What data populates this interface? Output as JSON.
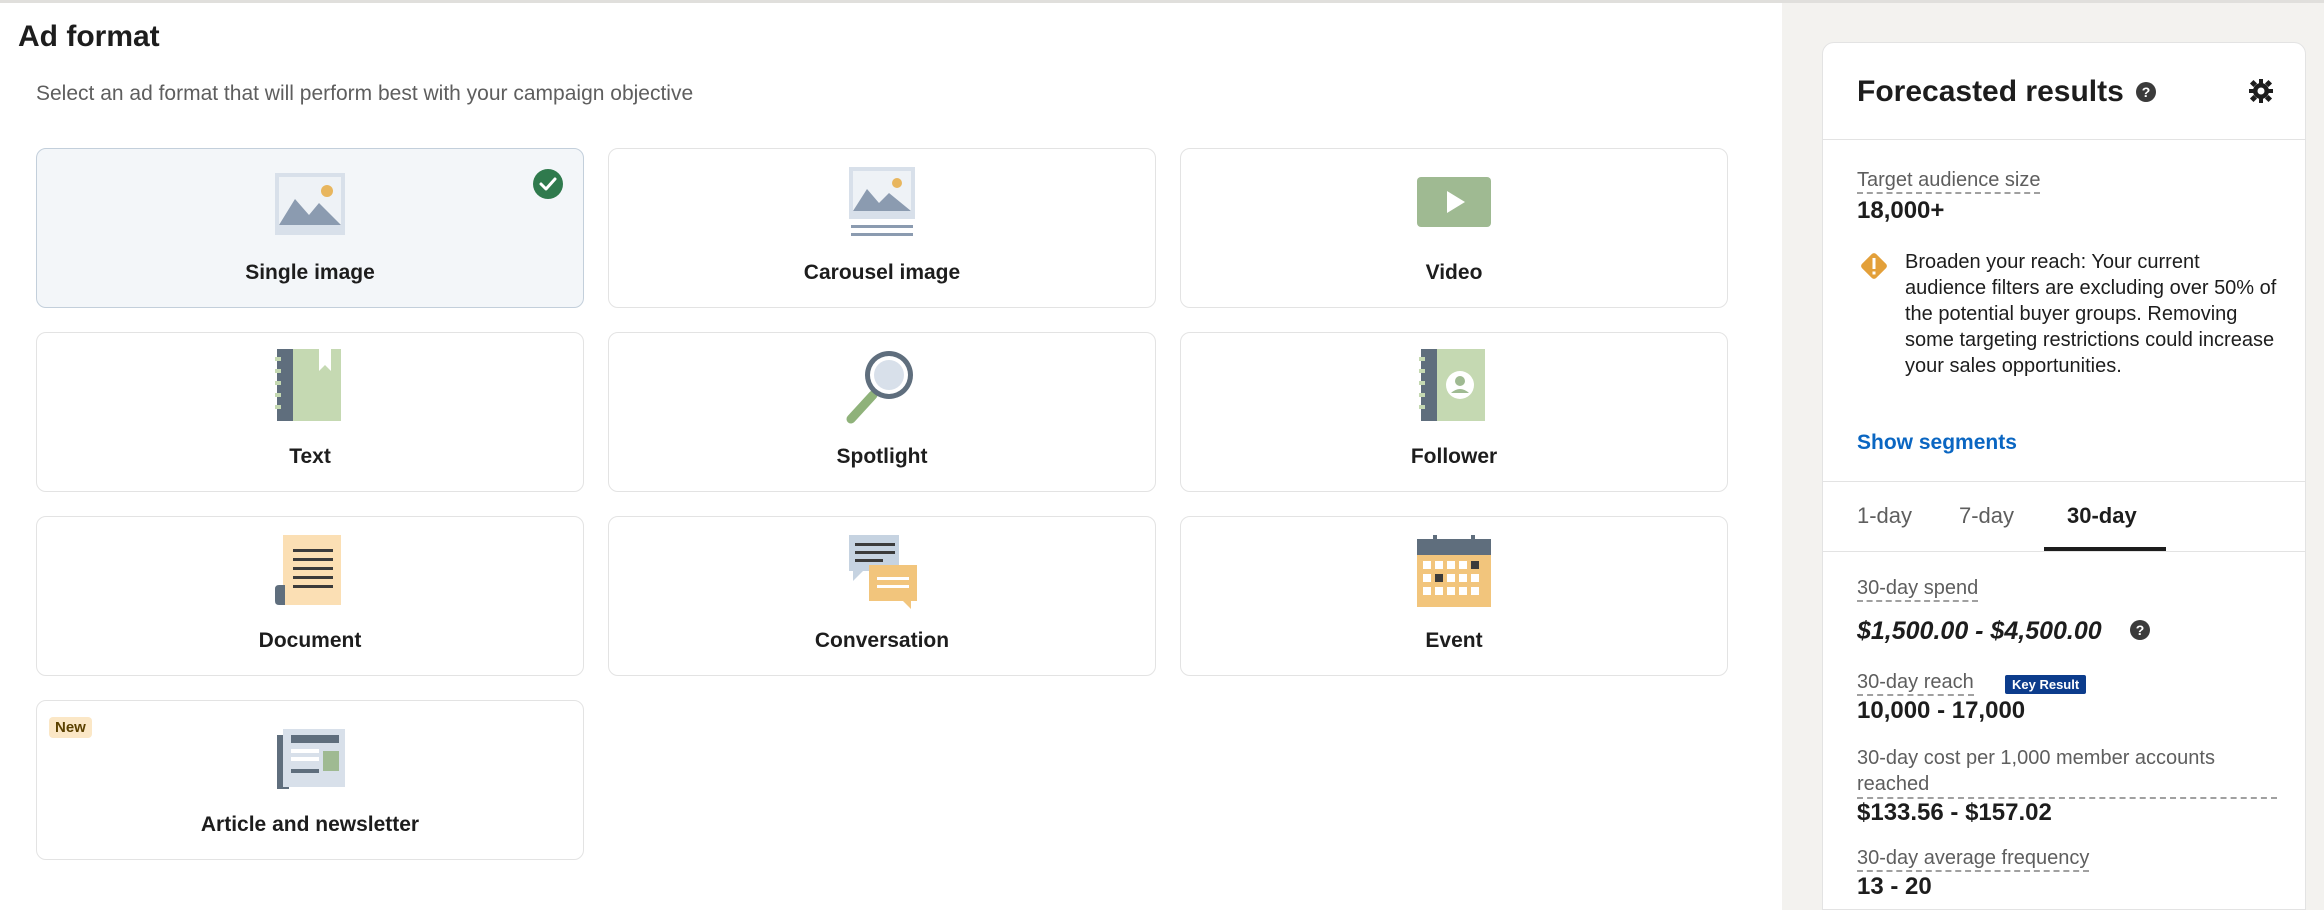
{
  "main": {
    "title": "Ad format",
    "subtitle": "Select an ad format that will perform best with your campaign objective",
    "formats": [
      {
        "label": "Single image",
        "icon": "single-image-icon",
        "selected": true
      },
      {
        "label": "Carousel image",
        "icon": "carousel-image-icon",
        "selected": false
      },
      {
        "label": "Video",
        "icon": "video-icon",
        "selected": false
      },
      {
        "label": "Text",
        "icon": "text-ad-icon",
        "selected": false
      },
      {
        "label": "Spotlight",
        "icon": "spotlight-icon",
        "selected": false
      },
      {
        "label": "Follower",
        "icon": "follower-icon",
        "selected": false
      },
      {
        "label": "Document",
        "icon": "document-icon",
        "selected": false
      },
      {
        "label": "Conversation",
        "icon": "conversation-icon",
        "selected": false
      },
      {
        "label": "Event",
        "icon": "event-icon",
        "selected": false
      },
      {
        "label": "Article and newsletter",
        "icon": "article-newsletter-icon",
        "selected": false,
        "badge": "New"
      }
    ]
  },
  "forecast": {
    "title": "Forecasted results",
    "audience_label": "Target audience size",
    "audience_value": "18,000+",
    "warning": "Broaden your reach: Your current audience filters are excluding over 50% of the potential buyer groups. Removing some targeting restrictions could increase your sales opportunities.",
    "show_segments": "Show segments",
    "tabs": [
      "1-day",
      "7-day",
      "30-day"
    ],
    "active_tab": "30-day",
    "spend_label": "30-day spend",
    "spend_value": "$1,500.00 - $4,500.00",
    "reach_label": "30-day reach",
    "reach_badge": "Key Result",
    "reach_value": "10,000 - 17,000",
    "cpm_label": "30-day cost per 1,000 member accounts reached",
    "cpm_value": "$133.56 - $157.02",
    "frequency_label": "30-day average frequency",
    "frequency_value": "13 - 20"
  },
  "colors": {
    "accent_link": "#0a66c2",
    "check_green": "#2f7a4d",
    "warning_orange": "#e3a03a",
    "key_badge": "#0c3c8c"
  }
}
